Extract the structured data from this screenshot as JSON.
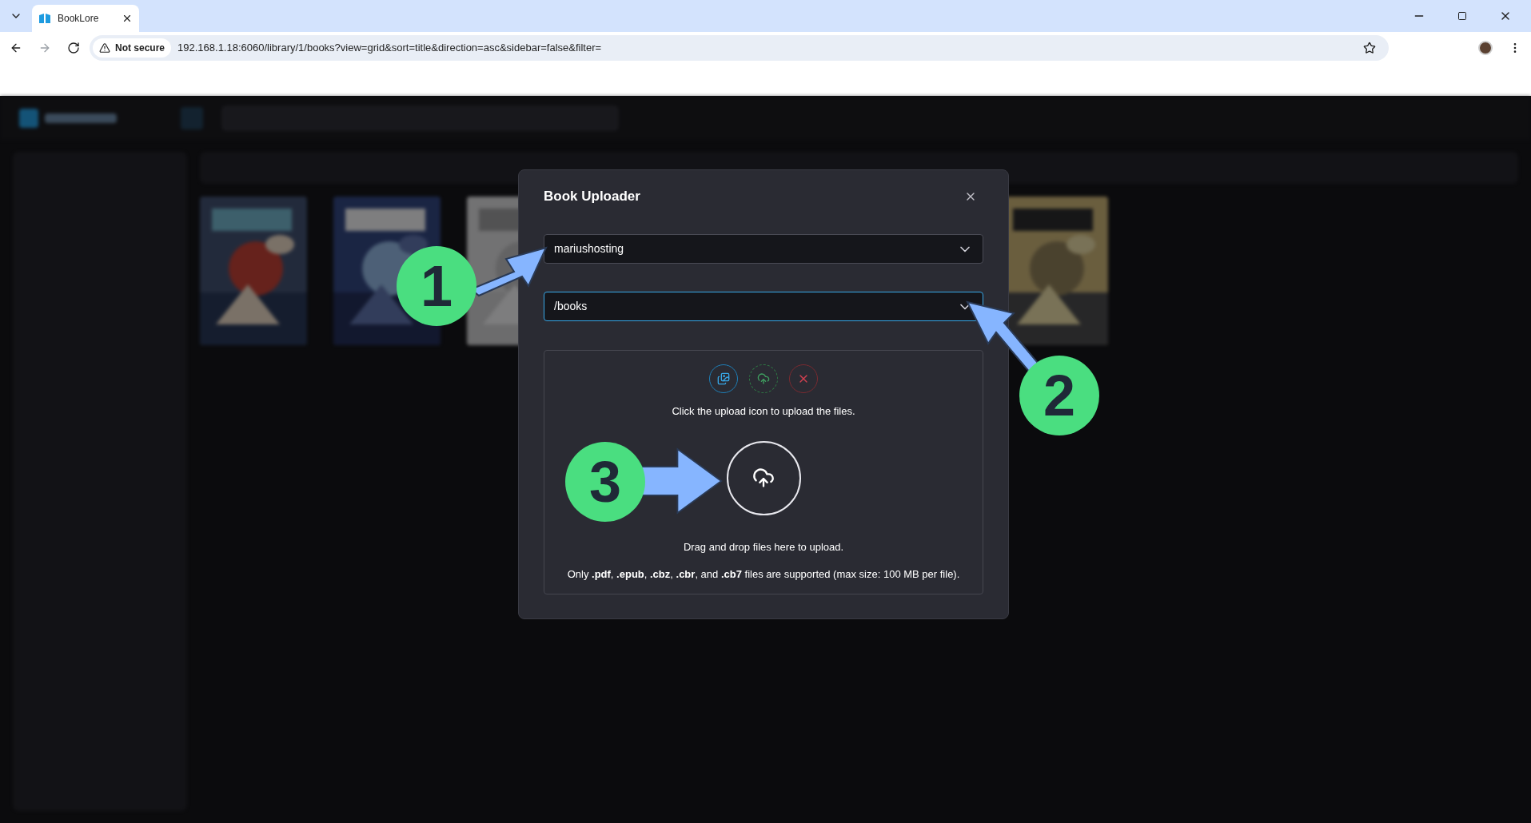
{
  "browser": {
    "tab_title": "BookLore",
    "security": "Not secure",
    "url": "192.168.1.18:6060/library/1/books?view=grid&sort=title&direction=asc&sidebar=false&filter="
  },
  "dialog": {
    "title": "Book Uploader",
    "library_select": {
      "value": "mariushosting"
    },
    "path_select": {
      "value": "/books",
      "focused": true
    },
    "dropzone": {
      "hint": "Click the upload icon to upload the files.",
      "drag_text": "Drag and drop files here to upload.",
      "formats_text": "Only **.pdf**, **.epub**, **.cbz**, **.cbr**, and **.cb7** files are supported (max size: 100 MB per file)."
    }
  },
  "annotations": [
    {
      "label": "1"
    },
    {
      "label": "2"
    },
    {
      "label": "3"
    }
  ]
}
